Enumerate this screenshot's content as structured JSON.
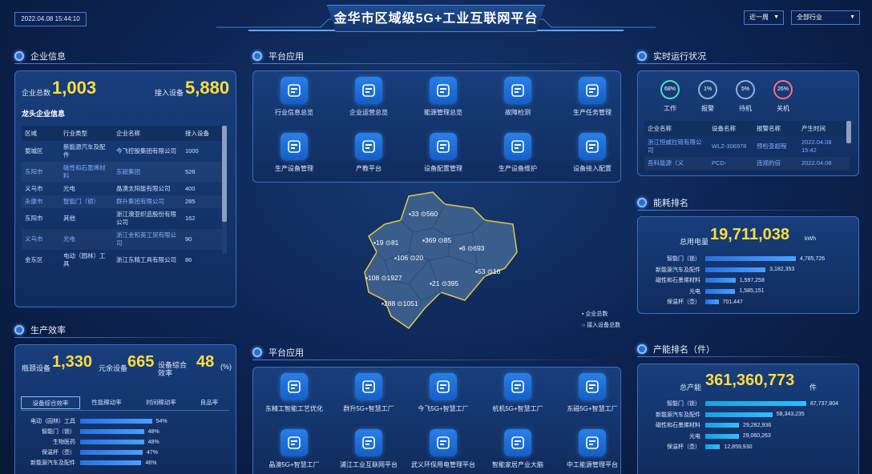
{
  "header": {
    "title": "金华市区域级5G+工业互联网平台",
    "datetime": "2022.04.08 15:44:10",
    "period": "近一周",
    "industry": "全部行业"
  },
  "sections": {
    "enterprise": "企业信息",
    "production": "生产效率",
    "apps1": "平台应用",
    "apps2": "平台应用",
    "status": "实时运行状况",
    "energy": "能耗排名",
    "capacity": "产能排名（件）"
  },
  "enterprise": {
    "total_label": "企业总数",
    "total": "1,003",
    "devices_label": "接入设备",
    "devices": "5,880",
    "leader_title": "龙头企业信息",
    "columns": [
      "区域",
      "行业类型",
      "企业名称",
      "接入设备"
    ],
    "rows": [
      {
        "region": "婺城区",
        "industry": "新能源汽车及配件",
        "name": "今飞控股集团有限公司",
        "devices": "1000"
      },
      {
        "region": "东阳市",
        "industry": "磁性和石墨烯材料",
        "name": "东磁集团",
        "devices": "526"
      },
      {
        "region": "义乌市",
        "industry": "光电",
        "name": "晶澳太阳能有限公司",
        "devices": "400"
      },
      {
        "region": "永康市",
        "industry": "智能门（锁）",
        "name": "群升集团有限公司",
        "devices": "285"
      },
      {
        "region": "东阳市",
        "industry": "其他",
        "name": "浙江澳亚织造股份有限公司",
        "devices": "162"
      },
      {
        "region": "义乌市",
        "industry": "光电",
        "name": "浙江金和英工贸有限公司",
        "devices": "90"
      },
      {
        "region": "金东区",
        "industry": "电动（园林）工具",
        "name": "浙江东精工具有限公司",
        "devices": "86"
      }
    ]
  },
  "production": {
    "devices_label": "瓶颈设备",
    "devices": "1,330",
    "unit1": "元余设备",
    "spare": "665",
    "oee_label": "设备综合效率",
    "oee": "48",
    "unit2": "(%)",
    "tabs": [
      "设备综合效率",
      "性能稼动率",
      "时间稼动率",
      "良品率"
    ],
    "bars": [
      {
        "name": "电动（园林）工具",
        "value": 54
      },
      {
        "name": "智能门（锁）",
        "value": 48
      },
      {
        "name": "生物医药",
        "value": 48
      },
      {
        "name": "保温杯（壶）",
        "value": 47
      },
      {
        "name": "新能源汽车及配件",
        "value": 46
      }
    ]
  },
  "apps1": [
    {
      "label": "行业信息总览",
      "icon": "dashboard-icon"
    },
    {
      "label": "企业运营总览",
      "icon": "pie-icon"
    },
    {
      "label": "能源管理总览",
      "icon": "energy-doc-icon"
    },
    {
      "label": "故障检测",
      "icon": "alert-icon"
    },
    {
      "label": "生产任务管理",
      "icon": "gear-icon"
    },
    {
      "label": "生产设备管理",
      "icon": "router-icon"
    },
    {
      "label": "产教平台",
      "icon": "chat-icon"
    },
    {
      "label": "设备配置管理",
      "icon": "list-icon"
    },
    {
      "label": "生产设备维护",
      "icon": "chart-icon"
    },
    {
      "label": "设备接入配置",
      "icon": "cloud-icon"
    }
  ],
  "apps2": [
    {
      "label": "东精工智能工艺优化",
      "icon": "factory-icon"
    },
    {
      "label": "群升5G+智慧工厂",
      "icon": "door-icon"
    },
    {
      "label": "今飞5G+智慧工厂",
      "icon": "wheel-icon"
    },
    {
      "label": "杭机5G+智慧工厂",
      "icon": "machine-icon"
    },
    {
      "label": "东磁5G+智慧工厂",
      "icon": "magnet-icon"
    },
    {
      "label": "晶澳5G+智慧工厂",
      "icon": "solar-icon"
    },
    {
      "label": "浦江工业互联网平台",
      "icon": "lock-icon"
    },
    {
      "label": "武义环保用电管理平台",
      "icon": "house-icon"
    },
    {
      "label": "智能家居产业大脑",
      "icon": "brain-icon"
    },
    {
      "label": "中工能源管理平台",
      "icon": "ml-icon"
    }
  ],
  "map": {
    "labels": [
      {
        "t": "33 ⊙560"
      },
      {
        "t": "19 ⊙81"
      },
      {
        "t": "369 ⊙85"
      },
      {
        "t": "6 ⊙693"
      },
      {
        "t": "106 ⊙20"
      },
      {
        "t": "108 ⊙1927"
      },
      {
        "t": "21 ⊙395"
      },
      {
        "t": "53 ⊙16"
      },
      {
        "t": "288 ⊙1051"
      }
    ],
    "legend1": "企业总数",
    "legend2": "接入设备总数"
  },
  "status": {
    "rings": [
      {
        "pct": "68%",
        "label": "工作"
      },
      {
        "pct": "1%",
        "label": "报警"
      },
      {
        "pct": "5%",
        "label": "待机"
      },
      {
        "pct": "26%",
        "label": "关机"
      }
    ],
    "columns": [
      "企业名称",
      "设备名称",
      "报警名称",
      "产生时间"
    ],
    "rows": [
      {
        "name": "浙江恒威拉链有限公司",
        "device": "WLZ-306978",
        "alarm": "预检查超程",
        "time": "2022.04.08 15:42"
      },
      {
        "name": "吾科能源（义",
        "device": "PCD-",
        "alarm": "违规的倍",
        "time": "2022.04.08"
      }
    ]
  },
  "energy": {
    "total_label": "总用电量",
    "total": "19,711,038",
    "unit": "kWh",
    "bars": [
      {
        "name": "智能门（锁）",
        "value": "4,785,726",
        "n": 4785726
      },
      {
        "name": "新能源汽车及配件",
        "value": "3,182,353",
        "n": 3182353
      },
      {
        "name": "磁性和石墨烯材料",
        "value": "1,597,258",
        "n": 1597258
      },
      {
        "name": "光电",
        "value": "1,585,151",
        "n": 1585151
      },
      {
        "name": "保温杯（壶）",
        "value": "701,447",
        "n": 701447
      }
    ]
  },
  "capacity": {
    "total_label": "总产能",
    "total": "361,360,773",
    "unit": "件",
    "bars": [
      {
        "name": "智能门（锁）",
        "value": "87,737,804",
        "n": 87737804
      },
      {
        "name": "新能源汽车及配件",
        "value": "58,343,235",
        "n": 58343235
      },
      {
        "name": "磁性和石墨烯材料",
        "value": "29,282,936",
        "n": 29282936
      },
      {
        "name": "光电",
        "value": "29,060,263",
        "n": 29060263
      },
      {
        "name": "保温杯（壶）",
        "value": "12,859,930",
        "n": 12859930
      }
    ]
  }
}
